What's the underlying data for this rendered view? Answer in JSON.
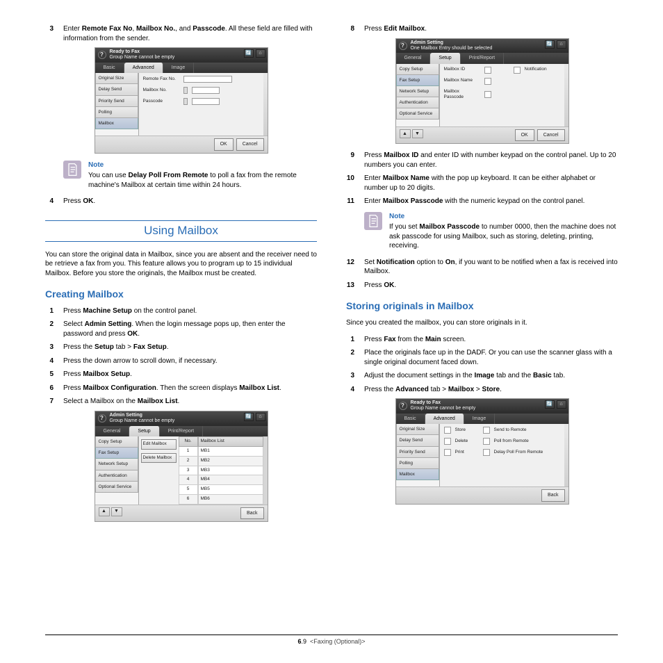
{
  "left": {
    "step3_pre": "Enter ",
    "step3_b1": "Remote Fax No",
    "step3_mid1": ", ",
    "step3_b2": "Mailbox No.",
    "step3_mid2": ", and ",
    "step3_b3": "Passcode",
    "step3_post": ". All these field are filled with information from the sender.",
    "note_label": "Note",
    "note_body_pre": "You can use ",
    "note_body_b": "Delay Poll From Remote",
    "note_body_post": " to poll a fax from the remote machine's Mailbox at certain time within 24 hours.",
    "step4_pre": "Press ",
    "step4_b": "OK",
    "step4_post": ".",
    "h1": "Using Mailbox",
    "intro": "You can store the original data in Mailbox, since you are absent and the receiver need to be retrieve a fax from you. This feature allows you to program up to 15 individual Mailbox. Before you store the originals, the Mailbox must be created.",
    "h2": "Creating Mailbox",
    "c1_pre": "Press ",
    "c1_b": "Machine Setup",
    "c1_post": " on the control panel.",
    "c2_pre": "Select ",
    "c2_b1": "Admin Setting",
    "c2_mid": ". When the login message pops up, then enter the password and press ",
    "c2_b2": "OK",
    "c2_post": ".",
    "c3_pre": "Press the ",
    "c3_b1": "Setup",
    "c3_mid": " tab > ",
    "c3_b2": "Fax Setup",
    "c3_post": ".",
    "c4": "Press the down arrow to scroll down, if necessary.",
    "c5_pre": "Press ",
    "c5_b": "Mailbox Setup",
    "c5_post": ".",
    "c6_pre": "Press ",
    "c6_b1": "Mailbox Configuration",
    "c6_mid": ". Then the screen displays ",
    "c6_b2": "Mailbox List",
    "c6_post": ".",
    "c7_pre": "Select a Mailbox on the ",
    "c7_b": "Mailbox List",
    "c7_post": "."
  },
  "right": {
    "r8_pre": "Press ",
    "r8_b": "Edit Mailbox",
    "r8_post": ".",
    "r9_pre": "Press ",
    "r9_b": "Mailbox ID",
    "r9_post": " and enter ID with number keypad on the control panel. Up to 20 numbers you can enter.",
    "r10_pre": "Enter ",
    "r10_b": "Mailbox Name",
    "r10_post": " with the pop up keyboard. It can be either alphabet or number up to 20 digits.",
    "r11_pre": "Enter ",
    "r11_b": "Mailbox Passcode",
    "r11_post": " with the numeric keypad on the control panel.",
    "note_label": "Note",
    "note_pre": "If you set ",
    "note_b": "Mailbox Passcode",
    "note_post": " to number 0000, then the machine does not ask passcode for using Mailbox, such as storing, deleting, printing, receiving.",
    "r12_pre": "Set ",
    "r12_b1": "Notification",
    "r12_mid": " option to ",
    "r12_b2": "On",
    "r12_post": ", if you want to be notified when a fax is received into Mailbox.",
    "r13_pre": "Press ",
    "r13_b": "OK",
    "r13_post": ".",
    "h2": "Storing originals in Mailbox",
    "s_intro": "Since you created the mailbox, you can store originals in it.",
    "s1_pre": "Press ",
    "s1_b1": "Fax",
    "s1_mid": " from the ",
    "s1_b2": "Main",
    "s1_post": " screen.",
    "s2": "Place the originals face up in the DADF. Or you can use the scanner glass with a single original document faced down.",
    "s3_pre": "Adjust the document settings in the ",
    "s3_b1": "Image",
    "s3_mid": " tab and the ",
    "s3_b2": "Basic",
    "s3_post": " tab.",
    "s4_pre": "Press the ",
    "s4_b1": "Advanced",
    "s4_mid1": " tab > ",
    "s4_b2": "Mailbox",
    "s4_mid2": " > ",
    "s4_b3": "Store",
    "s4_post": "."
  },
  "ui1": {
    "title_a": "Ready to Fax",
    "title_b": "Group Name cannot be empty",
    "tabs": {
      "basic": "Basic",
      "advanced": "Advanced",
      "image": "Image"
    },
    "side": [
      "Original Size",
      "Delay Send",
      "Priority Send",
      "Polling",
      "Mailbox"
    ],
    "fields": {
      "f1": "Remote Fax No.",
      "f2": "Mailbox No.",
      "f3": "Passcode"
    },
    "ok": "OK",
    "cancel": "Cancel"
  },
  "ui2": {
    "title_a": "Admin Setting",
    "title_b": "Group Name cannot be empty",
    "tabs": {
      "general": "General",
      "setup": "Setup",
      "print": "Print/Report"
    },
    "side": [
      "Copy Setup",
      "Fax Setup",
      "Network Setup",
      "Authentication",
      "Optional Service"
    ],
    "midbtns": {
      "edit": "Edit Mailbox",
      "del": "Delete Mailbox"
    },
    "listhead": {
      "no": "No.",
      "list": "Mailbox List"
    },
    "rows": [
      "MB1",
      "MB2",
      "MB3",
      "MB4",
      "MB5",
      "MB6"
    ],
    "back": "Back"
  },
  "ui3": {
    "title_a": "Admin Setting",
    "title_b": "One Mailbox Entry should be selected",
    "tabs": {
      "general": "General",
      "setup": "Setup",
      "print": "Print/Report"
    },
    "side": [
      "Copy Setup",
      "Fax Setup",
      "Network Setup",
      "Authentication",
      "Optional Service"
    ],
    "fields": {
      "f1": "Mailbox ID",
      "f2": "Mailbox Name",
      "f3": "Mailbox Passcode",
      "notif": "Notification"
    },
    "ok": "OK",
    "cancel": "Cancel"
  },
  "ui4": {
    "title_a": "Ready to Fax",
    "title_b": "Group Name cannot be empty",
    "tabs": {
      "basic": "Basic",
      "advanced": "Advanced",
      "image": "Image"
    },
    "side": [
      "Original Size",
      "Delay Send",
      "Priority Send",
      "Polling",
      "Mailbox"
    ],
    "btns": {
      "store": "Store",
      "send": "Send to Remote",
      "delete": "Delete",
      "poll": "Poll from Remote",
      "print": "Print",
      "dpfr": "Delay Poll From Remote"
    },
    "back": "Back"
  },
  "footer": {
    "chap": "6",
    "page": ".9",
    "section": "<Faxing (Optional)>"
  }
}
